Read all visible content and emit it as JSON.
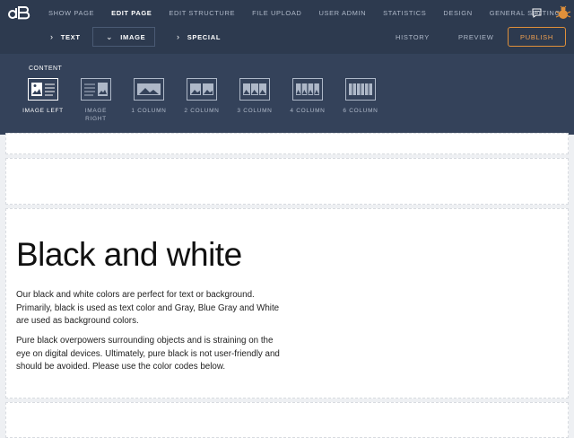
{
  "header": {
    "nav": [
      "SHOW PAGE",
      "EDIT PAGE",
      "EDIT STRUCTURE",
      "FILE UPLOAD",
      "USER ADMIN",
      "STATISTICS",
      "DESIGN",
      "GENERAL SETTINGS"
    ],
    "active_nav": "EDIT PAGE"
  },
  "subbar": {
    "text_tab": "TEXT",
    "image_tab": "IMAGE",
    "special_tab": "SPECIAL",
    "history": "HISTORY",
    "preview": "PREVIEW",
    "publish": "PUBLISH"
  },
  "panel": {
    "label": "CONTENT",
    "tools": [
      {
        "label": "IMAGE LEFT",
        "icon": "image-left-icon"
      },
      {
        "label": "IMAGE\nRIGHT",
        "icon": "image-right-icon"
      },
      {
        "label": "1 COLUMN",
        "icon": "one-column-icon"
      },
      {
        "label": "2 COLUMN",
        "icon": "two-column-icon"
      },
      {
        "label": "3 COLUMN",
        "icon": "three-column-icon"
      },
      {
        "label": "4 COLUMN",
        "icon": "four-column-icon"
      },
      {
        "label": "6 COLUMN",
        "icon": "six-column-icon"
      }
    ]
  },
  "content": {
    "heading": "Black and white",
    "paragraphs": [
      "Our black and white colors are perfect for text or background. Primarily, black is used as text color and Gray, Blue Gray and White are used as background colors.",
      "Pure black overpowers surrounding objects and is straining on the eye on digital devices. Ultimately, pure black is not user-friendly and should be avoided. Please use the color codes below."
    ]
  },
  "colors": {
    "topbar": "#2d3a4f",
    "panel": "#34425a",
    "publish_accent": "#e0903a"
  }
}
